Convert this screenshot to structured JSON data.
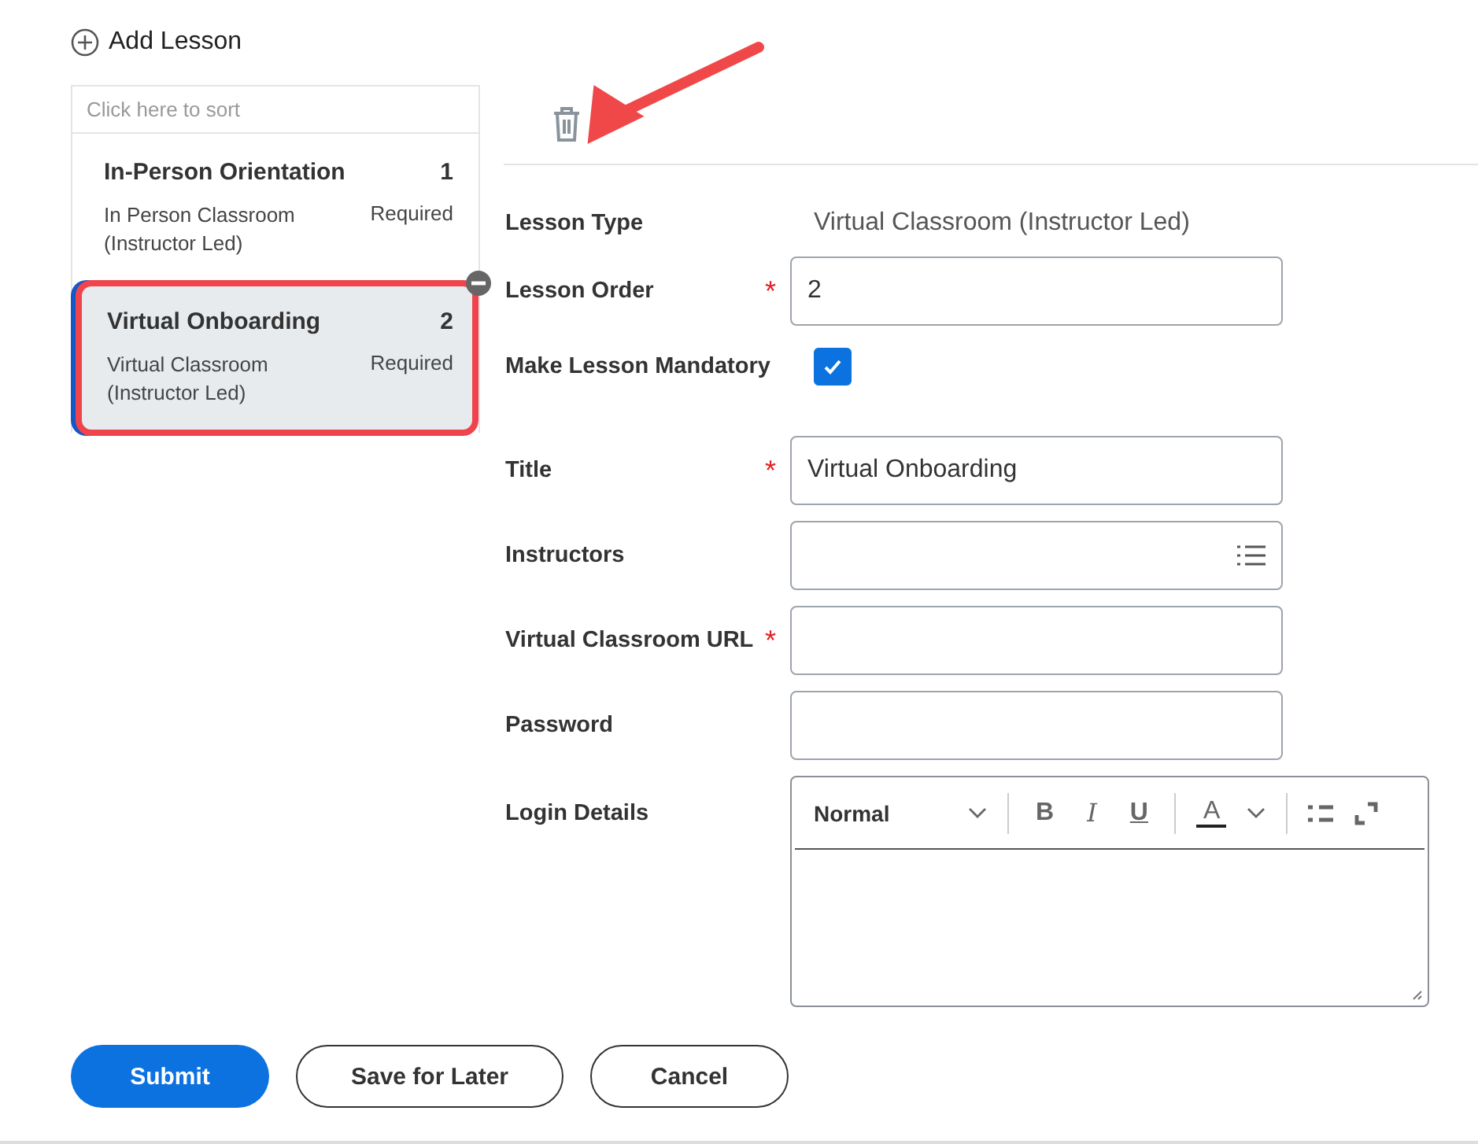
{
  "add_lesson": "Add Lesson",
  "sort_hint": "Click here to sort",
  "lessons": [
    {
      "title": "In-Person Orientation",
      "order": "1",
      "type": "In Person Classroom (Instructor Led)",
      "status": "Required",
      "selected": false
    },
    {
      "title": "Virtual Onboarding",
      "order": "2",
      "type": "Virtual Classroom (Instructor Led)",
      "status": "Required",
      "selected": true
    }
  ],
  "fields": [
    {
      "kind": "text",
      "label": "Lesson Type",
      "value": "Virtual Classroom (Instructor Led)"
    },
    {
      "kind": "input",
      "label": "Lesson Order",
      "required_mark": "*",
      "value": "2"
    },
    {
      "kind": "checkbox",
      "label": "Make Lesson Mandatory",
      "checked": true
    },
    {
      "kind": "input",
      "label": "Title",
      "required_mark": "*",
      "value": "Virtual Onboarding"
    },
    {
      "kind": "list",
      "label": "Instructors"
    },
    {
      "kind": "input",
      "label": "Virtual Classroom URL",
      "required_mark": "*"
    },
    {
      "kind": "input",
      "label": "Password"
    },
    {
      "kind": "editor",
      "label": "Login Details",
      "format": "Normal",
      "tools": [
        "B",
        "I",
        "U",
        "A"
      ]
    }
  ],
  "buttons": [
    {
      "label": "Submit",
      "kind": "primary"
    },
    {
      "label": "Save for Later",
      "kind": "secondary"
    },
    {
      "label": "Cancel",
      "kind": "secondary"
    }
  ]
}
